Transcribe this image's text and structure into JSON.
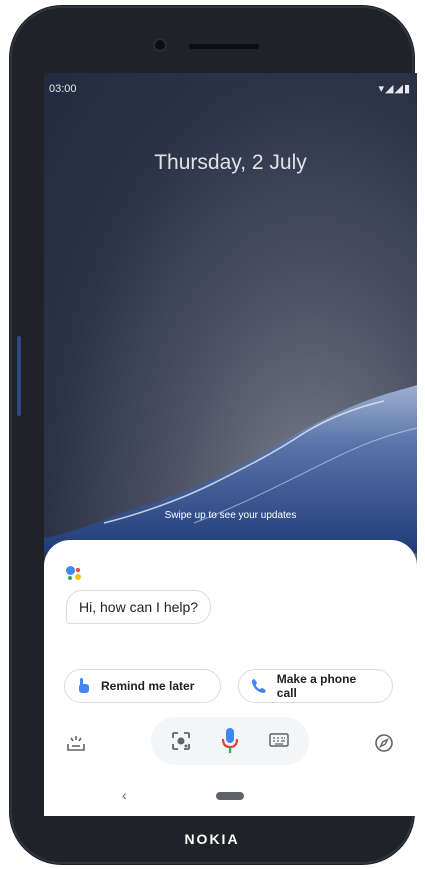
{
  "status_bar": {
    "time": "03:00",
    "icons": "▾◢◢▮"
  },
  "lock_screen": {
    "date": "Thursday, 2 July",
    "swipe_hint": "Swipe up to see your updates"
  },
  "assistant": {
    "greeting": "Hi, how can I help?",
    "suggestions": [
      {
        "label": "Remind me later",
        "icon": "hand-pointer-icon"
      },
      {
        "label": "Make a phone call",
        "icon": "phone-icon"
      }
    ],
    "tray": {
      "left_icon": "updates-icon",
      "center_icons": [
        "lens-icon",
        "microphone-icon",
        "keyboard-icon"
      ],
      "right_icon": "compass-icon"
    }
  },
  "navigation": {
    "back_symbol": "‹"
  },
  "device": {
    "brand": "NOKIA"
  },
  "colors": {
    "google_blue": "#4285f4",
    "google_red": "#ea4335",
    "google_yellow": "#fbbc05",
    "google_green": "#34a853"
  }
}
